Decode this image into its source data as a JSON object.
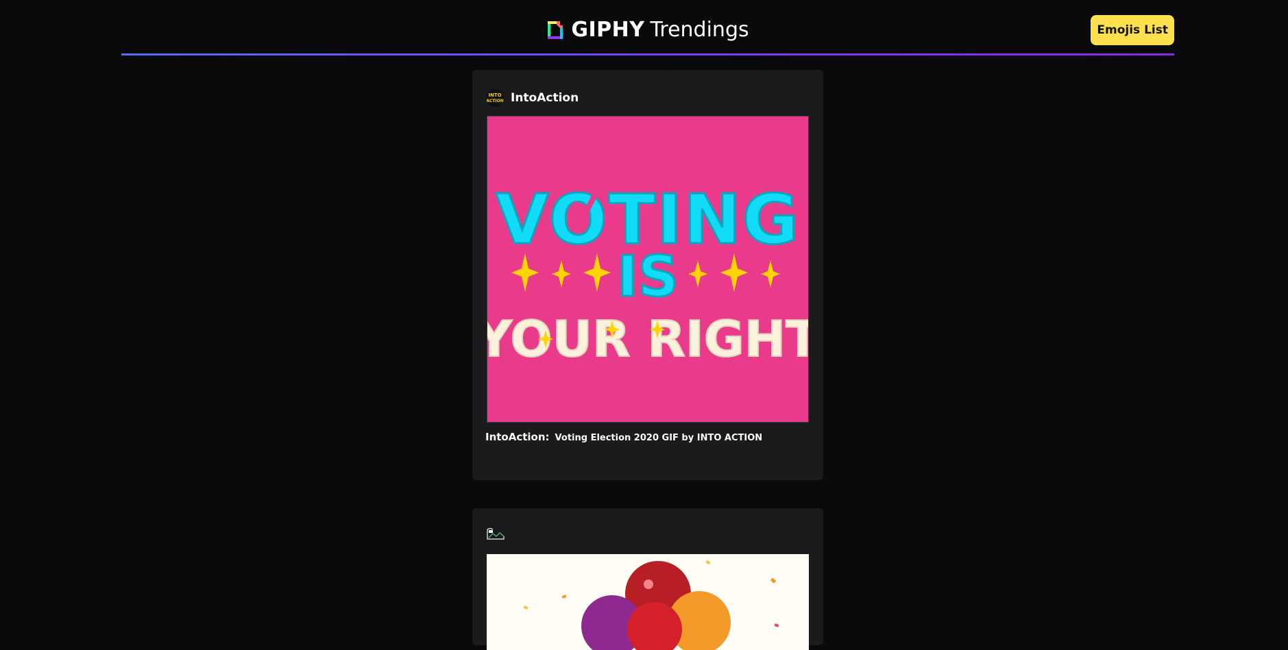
{
  "header": {
    "brand_bold": "GIPHY",
    "brand_rest": "Trendings",
    "emoji_button": "Emojis List"
  },
  "colors": {
    "accent_button": "#fde04e",
    "gradient_start": "#5b6cf5",
    "gradient_end": "#8a2be2",
    "card_bg": "#1b1b1e",
    "gif_bg": "#e93a8c"
  },
  "feed": [
    {
      "username": "IntoAction",
      "avatar_text": "INTO ACTION",
      "gif_text": [
        "VOTING",
        "IS",
        "YOUR RIGHT"
      ],
      "caption_user": "IntoAction:",
      "caption_title": "Voting Election 2020 GIF by INTO ACTION"
    },
    {
      "username": "",
      "avatar": "broken-image-icon",
      "gif_subject": "balloons"
    }
  ]
}
